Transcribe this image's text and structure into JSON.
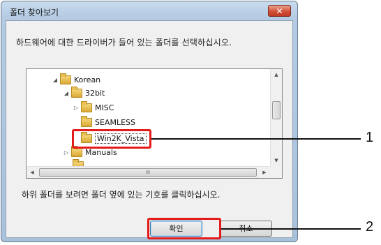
{
  "dialog": {
    "title": "폴더 찾아보기",
    "close_label": "✕",
    "instruction": "하드웨어에 대한 드라이버가 들어 있는 폴더를 선택하십시오.",
    "hint": "하위 폴더를 보려면 폴더 옆에 있는 기호를 클릭하십시오.",
    "ok_label": "확인",
    "cancel_label": "취소"
  },
  "tree": {
    "items": [
      {
        "label": "Korean",
        "expander": "◢",
        "depth": 0
      },
      {
        "label": "32bit",
        "expander": "◢",
        "depth": 1
      },
      {
        "label": "MISC",
        "expander": "▷",
        "depth": 2
      },
      {
        "label": "SEAMLESS",
        "expander": "",
        "depth": 2
      },
      {
        "label": "Win2K_Vista",
        "expander": "",
        "depth": 2,
        "selected": true
      },
      {
        "label": "Manuals",
        "expander": "▷",
        "depth": 1
      }
    ],
    "hscroll_grip": "III",
    "vscroll_grip": "≡"
  },
  "callouts": [
    {
      "number": "1",
      "target": "Win2K_Vista"
    },
    {
      "number": "2",
      "target": "확인"
    }
  ]
}
